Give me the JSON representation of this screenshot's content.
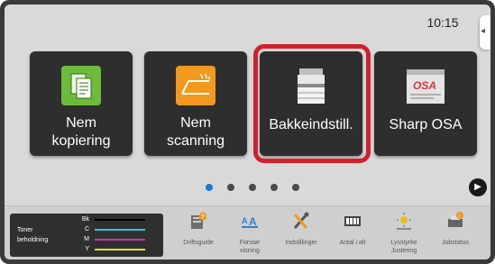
{
  "status": {
    "time": "10:15"
  },
  "tiles": [
    {
      "label_line1": "Nem",
      "label_line2": "kopiering",
      "icon": "copy-icon",
      "color": "#6dbb3a"
    },
    {
      "label_line1": "Nem",
      "label_line2": "scanning",
      "icon": "scan-icon",
      "color": "#f29a1d"
    },
    {
      "label_line1": "Bakkeindstill.",
      "label_line2": "",
      "icon": "printer-icon",
      "selected": true
    },
    {
      "label_line1": "Sharp OSA",
      "label_line2": "",
      "icon": "osa-icon"
    }
  ],
  "pager": {
    "pages": 5,
    "active": 1
  },
  "toner": {
    "label_line1": "Toner",
    "label_line2": "beholdning",
    "levels": [
      {
        "key": "Bk",
        "color": "#000000"
      },
      {
        "key": "C",
        "color": "#29c6d8"
      },
      {
        "key": "M",
        "color": "#c23aa8"
      },
      {
        "key": "Y",
        "color": "#e8d83a"
      }
    ]
  },
  "bottom_items": [
    {
      "label_line1": "Driftsguide",
      "label_line2": "",
      "icon": "guide-icon"
    },
    {
      "label_line1": "Forstør",
      "label_line2": "visning",
      "icon": "magnify-display-icon"
    },
    {
      "label_line1": "Indstillinger",
      "label_line2": "",
      "icon": "tools-icon"
    },
    {
      "label_line1": "Antal i alt",
      "label_line2": "",
      "icon": "counter-icon"
    },
    {
      "label_line1": "Lysstyrke",
      "label_line2": "Justering",
      "icon": "brightness-icon"
    },
    {
      "label_line1": "Jobstatus",
      "label_line2": "",
      "icon": "job-status-icon"
    }
  ]
}
